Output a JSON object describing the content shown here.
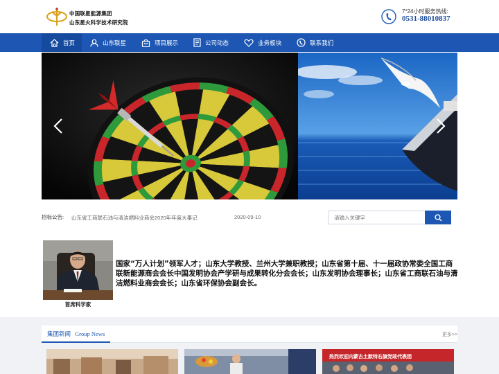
{
  "header": {
    "logo_line1": "中国联星能源集团",
    "logo_line2": "山东星火科学技术研究院",
    "hotline_label": "7*24小时服务热线:",
    "hotline_number": "0531-88010837"
  },
  "nav": {
    "items": [
      {
        "label": "首页",
        "icon": "home-icon"
      },
      {
        "label": "山东联星",
        "icon": "user-icon"
      },
      {
        "label": "项目展示",
        "icon": "bag-icon"
      },
      {
        "label": "公司动态",
        "icon": "document-icon"
      },
      {
        "label": "业务板块",
        "icon": "heart-icon"
      },
      {
        "label": "联系我们",
        "icon": "contact-icon"
      }
    ]
  },
  "notice": {
    "label": "招标公告:",
    "link_text": "山东省工商联石油与清洁燃料业商会2020年年度大事记",
    "date": "2020-09-10"
  },
  "search": {
    "placeholder": "请输入关键字"
  },
  "scientist": {
    "caption": "首席科学家",
    "description": "国家“万人计划”领军人才；山东大学教授、兰州大学兼职教授；山东省第十届、十一届政协常委全国工商联新能源商会会长中国发明协会产学研与成果转化分会会长；山东发明协会理事长；山东省工商联石油与清洁燃料业商会会长；山东省环保协会副会长。"
  },
  "news": {
    "tab_cn": "集团新闻",
    "tab_en": "Group News",
    "more": "更多>>",
    "card3_banner": "热烈欢迎内蒙古土默特右旗党政代表团"
  },
  "colors": {
    "brand_blue": "#1d57b3",
    "nav_active": "#154a9e",
    "news_bg": "#f0f2f5"
  }
}
